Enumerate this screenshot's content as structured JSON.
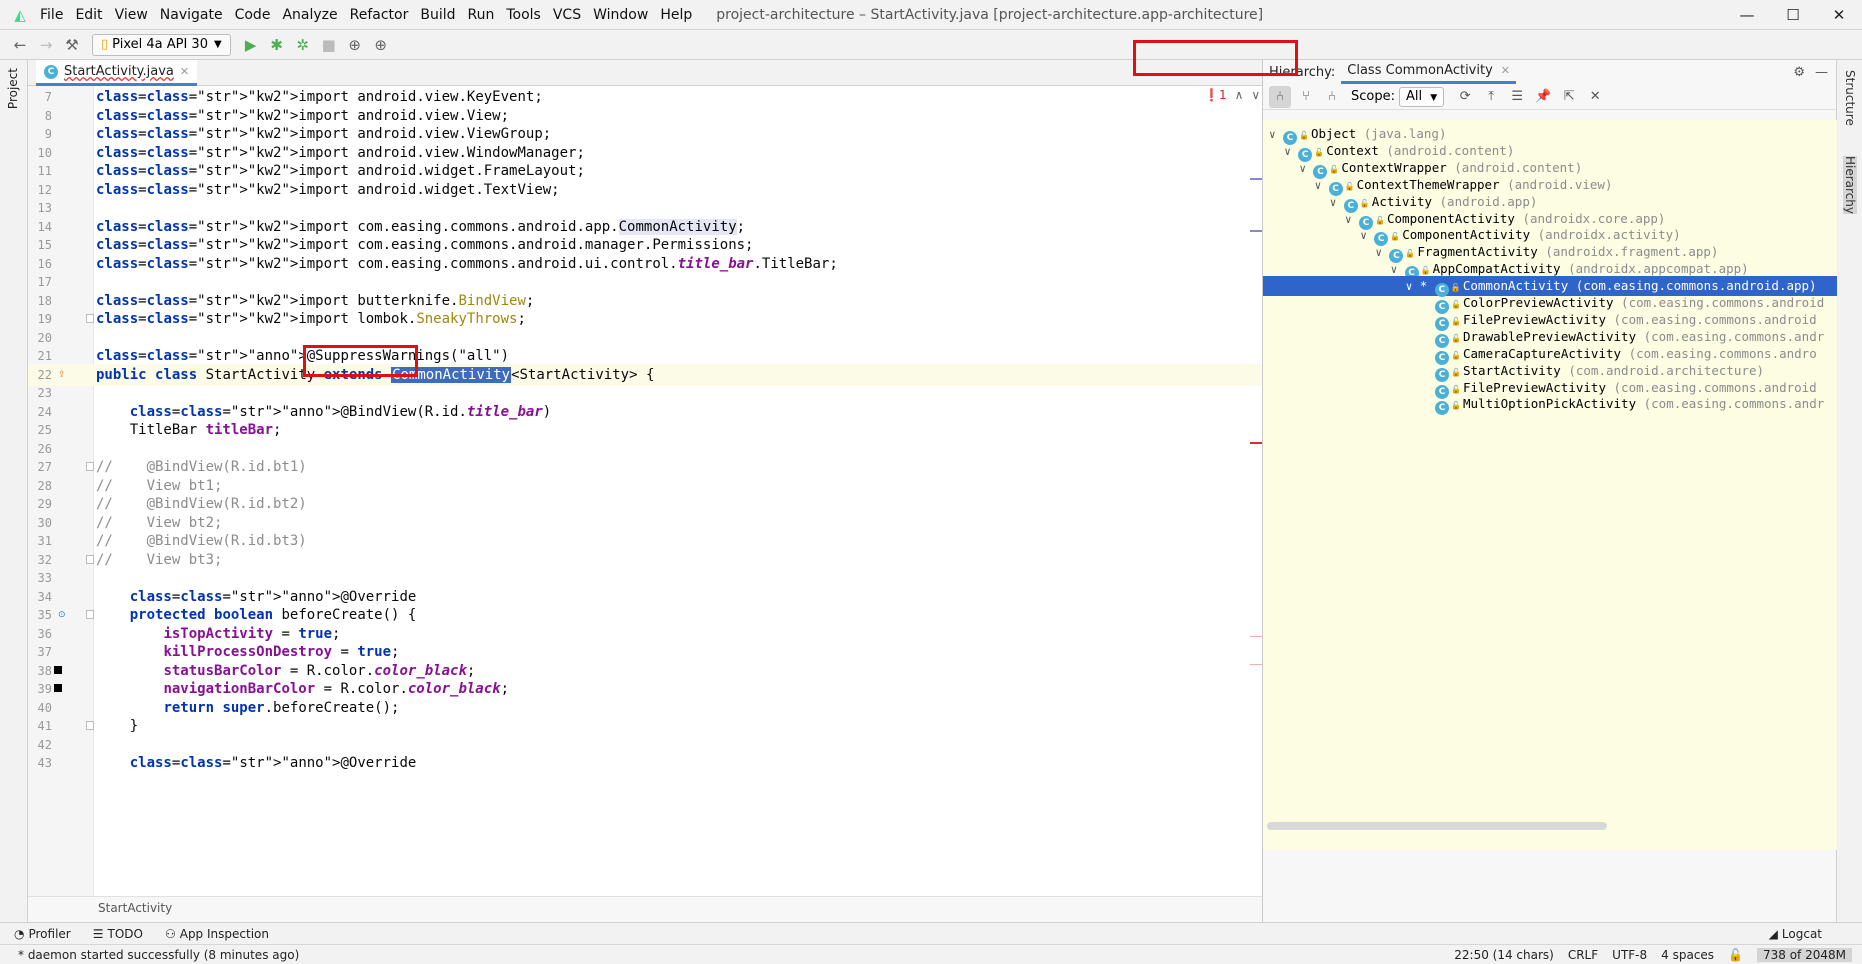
{
  "window": {
    "title": "project-architecture – StartActivity.java [project-architecture.app-architecture]",
    "menu": [
      "File",
      "Edit",
      "View",
      "Navigate",
      "Code",
      "Analyze",
      "Refactor",
      "Build",
      "Run",
      "Tools",
      "VCS",
      "Window",
      "Help"
    ]
  },
  "toolbar": {
    "device": "Pixel 4a API 30"
  },
  "left_tools": {
    "project": "Project"
  },
  "right_tools": {
    "structure": "Structure",
    "hierarchy": "Hierarchy"
  },
  "editor": {
    "tab_label": "StartActivity.java",
    "error_count": "1",
    "breadcrumb": "StartActivity",
    "lines": [
      {
        "n": "7",
        "t": "import android.view.KeyEvent;"
      },
      {
        "n": "8",
        "t": "import android.view.View;"
      },
      {
        "n": "9",
        "t": "import android.view.ViewGroup;"
      },
      {
        "n": "10",
        "t": "import android.view.WindowManager;"
      },
      {
        "n": "11",
        "t": "import android.widget.FrameLayout;"
      },
      {
        "n": "12",
        "t": "import android.widget.TextView;"
      },
      {
        "n": "13",
        "t": ""
      },
      {
        "n": "14",
        "t": "import com.easing.commons.android.app.CommonActivity;"
      },
      {
        "n": "15",
        "t": "import com.easing.commons.android.manager.Permissions;"
      },
      {
        "n": "16",
        "t": "import com.easing.commons.android.ui.control.title_bar.TitleBar;"
      },
      {
        "n": "17",
        "t": ""
      },
      {
        "n": "18",
        "t": "import butterknife.BindView;"
      },
      {
        "n": "19",
        "t": "import lombok.SneakyThrows;"
      },
      {
        "n": "20",
        "t": ""
      },
      {
        "n": "21",
        "t": "@SuppressWarnings(\"all\")"
      },
      {
        "n": "22",
        "t": "public class StartActivity extends CommonActivity<StartActivity> {"
      },
      {
        "n": "23",
        "t": ""
      },
      {
        "n": "24",
        "t": "    @BindView(R.id.title_bar)"
      },
      {
        "n": "25",
        "t": "    TitleBar titleBar;"
      },
      {
        "n": "26",
        "t": ""
      },
      {
        "n": "27",
        "t": "//    @BindView(R.id.bt1)"
      },
      {
        "n": "28",
        "t": "//    View bt1;"
      },
      {
        "n": "29",
        "t": "//    @BindView(R.id.bt2)"
      },
      {
        "n": "30",
        "t": "//    View bt2;"
      },
      {
        "n": "31",
        "t": "//    @BindView(R.id.bt3)"
      },
      {
        "n": "32",
        "t": "//    View bt3;"
      },
      {
        "n": "33",
        "t": ""
      },
      {
        "n": "34",
        "t": "    @Override"
      },
      {
        "n": "35",
        "t": "    protected boolean beforeCreate() {"
      },
      {
        "n": "36",
        "t": "        isTopActivity = true;"
      },
      {
        "n": "37",
        "t": "        killProcessOnDestroy = true;"
      },
      {
        "n": "38",
        "t": "        statusBarColor = R.color.color_black;"
      },
      {
        "n": "39",
        "t": "        navigationBarColor = R.color.color_black;"
      },
      {
        "n": "40",
        "t": "        return super.beforeCreate();"
      },
      {
        "n": "41",
        "t": "    }"
      },
      {
        "n": "42",
        "t": ""
      },
      {
        "n": "43",
        "t": "    @Override"
      }
    ]
  },
  "hierarchy": {
    "label": "Hierarchy:",
    "tab": "Class CommonActivity",
    "scope_label": "Scope:",
    "scope_value": "All",
    "tree": [
      {
        "name": "Object",
        "pkg": "(java.lang)",
        "depth": 0
      },
      {
        "name": "Context",
        "pkg": "(android.content)",
        "depth": 1
      },
      {
        "name": "ContextWrapper",
        "pkg": "(android.content)",
        "depth": 2
      },
      {
        "name": "ContextThemeWrapper",
        "pkg": "(android.view)",
        "depth": 3
      },
      {
        "name": "Activity",
        "pkg": "(android.app)",
        "depth": 4
      },
      {
        "name": "ComponentActivity",
        "pkg": "(androidx.core.app)",
        "depth": 5
      },
      {
        "name": "ComponentActivity",
        "pkg": "(androidx.activity)",
        "depth": 6
      },
      {
        "name": "FragmentActivity",
        "pkg": "(androidx.fragment.app)",
        "depth": 7
      },
      {
        "name": "AppCompatActivity",
        "pkg": "(androidx.appcompat.app)",
        "depth": 8
      },
      {
        "name": "CommonActivity",
        "pkg": "(com.easing.commons.android.app)",
        "depth": 9,
        "selected": true
      },
      {
        "name": "ColorPreviewActivity",
        "pkg": "(com.easing.commons.android",
        "depth": 10
      },
      {
        "name": "FilePreviewActivity",
        "pkg": "(com.easing.commons.android",
        "depth": 10
      },
      {
        "name": "DrawablePreviewActivity",
        "pkg": "(com.easing.commons.andr",
        "depth": 10
      },
      {
        "name": "CameraCaptureActivity",
        "pkg": "(com.easing.commons.andro",
        "depth": 10
      },
      {
        "name": "StartActivity",
        "pkg": "(com.android.architecture)",
        "depth": 10
      },
      {
        "name": "FilePreviewActivity",
        "pkg": "(com.easing.commons.android",
        "depth": 10
      },
      {
        "name": "MultiOptionPickActivity",
        "pkg": "(com.easing.commons.andr",
        "depth": 10
      }
    ]
  },
  "bottom_tools": {
    "profiler": "Profiler",
    "todo": "TODO",
    "app_inspection": "App Inspection",
    "logcat": "Logcat"
  },
  "status": {
    "message": "* daemon started successfully (8 minutes ago)",
    "position": "22:50 (14 chars)",
    "line_sep": "CRLF",
    "encoding": "UTF-8",
    "indent": "4 spaces",
    "memory": "738 of 2048M"
  }
}
